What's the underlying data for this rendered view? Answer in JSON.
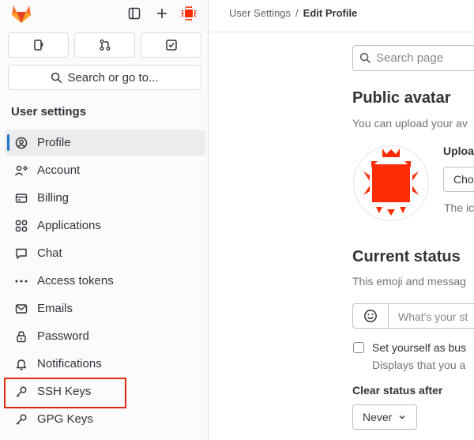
{
  "breadcrumb": {
    "parent": "User Settings",
    "separator": "/",
    "current": "Edit Profile"
  },
  "sidebar": {
    "search_label": "Search or go to...",
    "title": "User settings",
    "items": [
      {
        "label": "Profile",
        "icon": "profile-icon",
        "active": true
      },
      {
        "label": "Account",
        "icon": "account-icon"
      },
      {
        "label": "Billing",
        "icon": "credit-card-icon"
      },
      {
        "label": "Applications",
        "icon": "applications-icon"
      },
      {
        "label": "Chat",
        "icon": "comment-icon"
      },
      {
        "label": "Access tokens",
        "icon": "token-icon"
      },
      {
        "label": "Emails",
        "icon": "mail-icon"
      },
      {
        "label": "Password",
        "icon": "lock-icon"
      },
      {
        "label": "Notifications",
        "icon": "bell-icon"
      },
      {
        "label": "SSH Keys",
        "icon": "key-icon",
        "highlighted": true
      },
      {
        "label": "GPG Keys",
        "icon": "key-icon"
      }
    ]
  },
  "main": {
    "search_placeholder": "Search page",
    "avatar": {
      "heading": "Public avatar",
      "description": "You can upload your av",
      "upload_label": "Uploa",
      "choose_button": "Cho",
      "icon_note": "The ic"
    },
    "status": {
      "heading": "Current status",
      "description": "This emoji and messag",
      "input_placeholder": "What's your st",
      "busy_label": "Set yourself as bus",
      "busy_help": "Displays that you a",
      "clear_after_label": "Clear status after",
      "clear_after_value": "Never"
    }
  },
  "colors": {
    "brand": "#fc6d26",
    "accent": "#1f75cb",
    "avatar_red": "#fc2d05",
    "highlight": "#dd2b0e"
  }
}
